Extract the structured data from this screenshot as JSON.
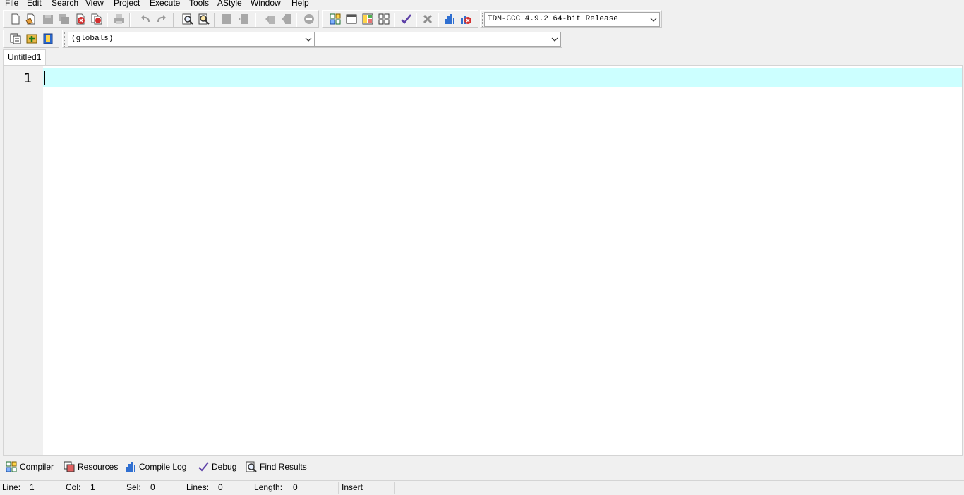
{
  "menu": {
    "file": "File",
    "edit": "Edit",
    "search": "Search",
    "view": "View",
    "project": "Project",
    "execute": "Execute",
    "tools": "Tools",
    "astyle": "AStyle",
    "window": "Window",
    "help": "Help"
  },
  "toolbar": {
    "compiler_select": "TDM-GCC 4.9.2 64-bit Release",
    "scope_select": "(globals)",
    "member_select": ""
  },
  "editor": {
    "tab_title": "Untitled1",
    "line_number": "1"
  },
  "bottom_tabs": {
    "compiler": "Compiler",
    "resources": "Resources",
    "compile_log": "Compile Log",
    "debug": "Debug",
    "find_results": "Find Results"
  },
  "status": {
    "line_label": "Line:",
    "line_value": "1",
    "col_label": "Col:",
    "col_value": "1",
    "sel_label": "Sel:",
    "sel_value": "0",
    "lines_label": "Lines:",
    "lines_value": "0",
    "length_label": "Length:",
    "length_value": "0",
    "mode": "Insert"
  },
  "colors": {
    "current_line": "#ccffff",
    "gutter": "#f0f0f0",
    "window_bg": "#f0f0f0"
  }
}
